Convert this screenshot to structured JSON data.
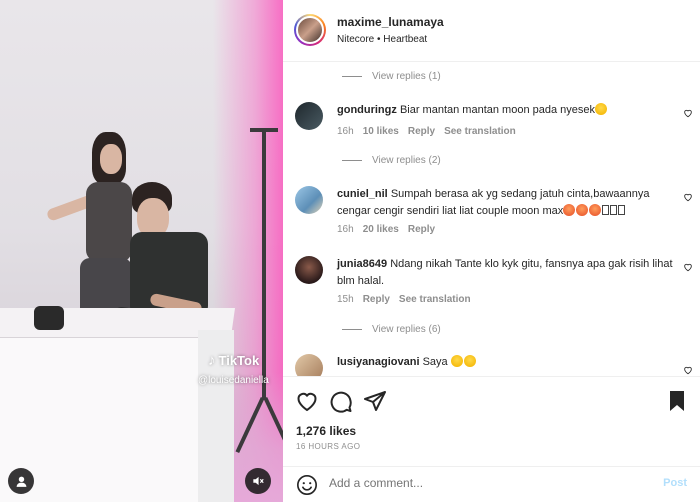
{
  "media": {
    "tiktok_label": "TikTok",
    "tiktok_handle": "@louisedaniella"
  },
  "post": {
    "username": "maxime_lunamaya",
    "subtitle": "Nitecore • Heartbeat",
    "likes": "1,276 likes",
    "time_ago": "16 HOURS AGO"
  },
  "replies": [
    {
      "label": "View replies (1)"
    },
    {
      "label": "View replies (2)"
    },
    {
      "label": "View replies (6)"
    }
  ],
  "comments": [
    {
      "user": "gonduringz",
      "text": "Biar mantan mantan moon pada nyesek",
      "emoji_count": 1,
      "age": "16h",
      "likes": "10 likes",
      "reply": "Reply",
      "see_translation": "See translation",
      "avatar_color": "#2f3a40"
    },
    {
      "user": "cuniel_nil",
      "text": "Sumpah berasa ak yg sedang jatuh cinta,bawaannya cengar cengir sendiri liat liat couple moon max",
      "emoji_count": 3,
      "age": "16h",
      "likes": "20 likes",
      "reply": "Reply",
      "avatar_color": "#8fb7d8"
    },
    {
      "user": "junia8649",
      "text": "Ndang nikah Tante klo kyk gitu, fansnya apa gak risih lihat blm halal.",
      "age": "15h",
      "reply": "Reply",
      "see_translation": "See translation",
      "avatar_color": "#4a2d2d"
    },
    {
      "user": "lusiyanagiovani",
      "text": "Saya",
      "emoji_count": 2,
      "avatar_color": "#c9a57e"
    }
  ],
  "add_comment": {
    "placeholder": "Add a comment...",
    "post_label": "Post"
  },
  "icons": {
    "heart": "heart-icon",
    "comment": "comment-icon",
    "share": "share-icon",
    "bookmark": "bookmark-icon",
    "smile": "smile-icon",
    "user": "user-icon",
    "mute": "mute-icon"
  },
  "colors": {
    "secondary_text": "#8e8e8e",
    "post_button": "#b2dffc",
    "primary_text": "#262626"
  }
}
